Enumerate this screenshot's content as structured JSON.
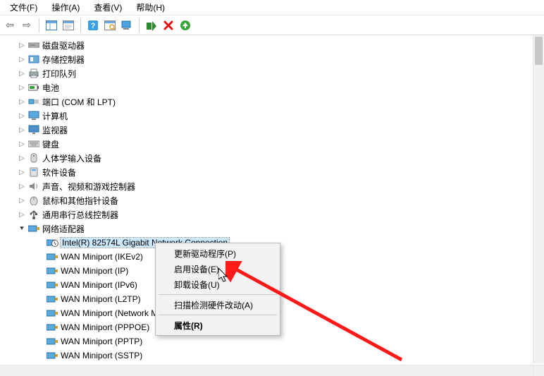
{
  "menubar": {
    "file": "文件(F)",
    "action": "操作(A)",
    "view": "查看(V)",
    "help": "帮助(H)"
  },
  "tree": {
    "items": [
      {
        "label": "磁盘驱动器",
        "iconName": "disk-drive-icon"
      },
      {
        "label": "存储控制器",
        "iconName": "storage-controller-icon"
      },
      {
        "label": "打印队列",
        "iconName": "printer-icon"
      },
      {
        "label": "电池",
        "iconName": "battery-icon"
      },
      {
        "label": "端口 (COM 和 LPT)",
        "iconName": "port-icon"
      },
      {
        "label": "计算机",
        "iconName": "computer-icon"
      },
      {
        "label": "监视器",
        "iconName": "monitor-icon"
      },
      {
        "label": "键盘",
        "iconName": "keyboard-icon"
      },
      {
        "label": "人体学输入设备",
        "iconName": "hid-icon"
      },
      {
        "label": "软件设备",
        "iconName": "software-device-icon"
      },
      {
        "label": "声音、视频和游戏控制器",
        "iconName": "sound-icon"
      },
      {
        "label": "鼠标和其他指针设备",
        "iconName": "mouse-icon"
      },
      {
        "label": "通用串行总线控制器",
        "iconName": "usb-icon"
      },
      {
        "label": "网络适配器",
        "iconName": "network-adapter-icon",
        "expanded": true
      }
    ],
    "networkChildren": [
      {
        "label": "Intel(R) 82574L Gigabit Network Connection",
        "selected": true,
        "disabled": true
      },
      {
        "label": "WAN Miniport (IKEv2)"
      },
      {
        "label": "WAN Miniport (IP)"
      },
      {
        "label": "WAN Miniport (IPv6)"
      },
      {
        "label": "WAN Miniport (L2TP)"
      },
      {
        "label": "WAN Miniport (Network Monitor)"
      },
      {
        "label": "WAN Miniport (PPPOE)"
      },
      {
        "label": "WAN Miniport (PPTP)"
      },
      {
        "label": "WAN Miniport (SSTP)"
      }
    ]
  },
  "contextMenu": {
    "updateDriver": "更新驱动程序(P)",
    "enableDevice": "启用设备(E)",
    "uninstallDevice": "卸载设备(U)",
    "scanHardware": "扫描检测硬件改动(A)",
    "properties": "属性(R)"
  }
}
